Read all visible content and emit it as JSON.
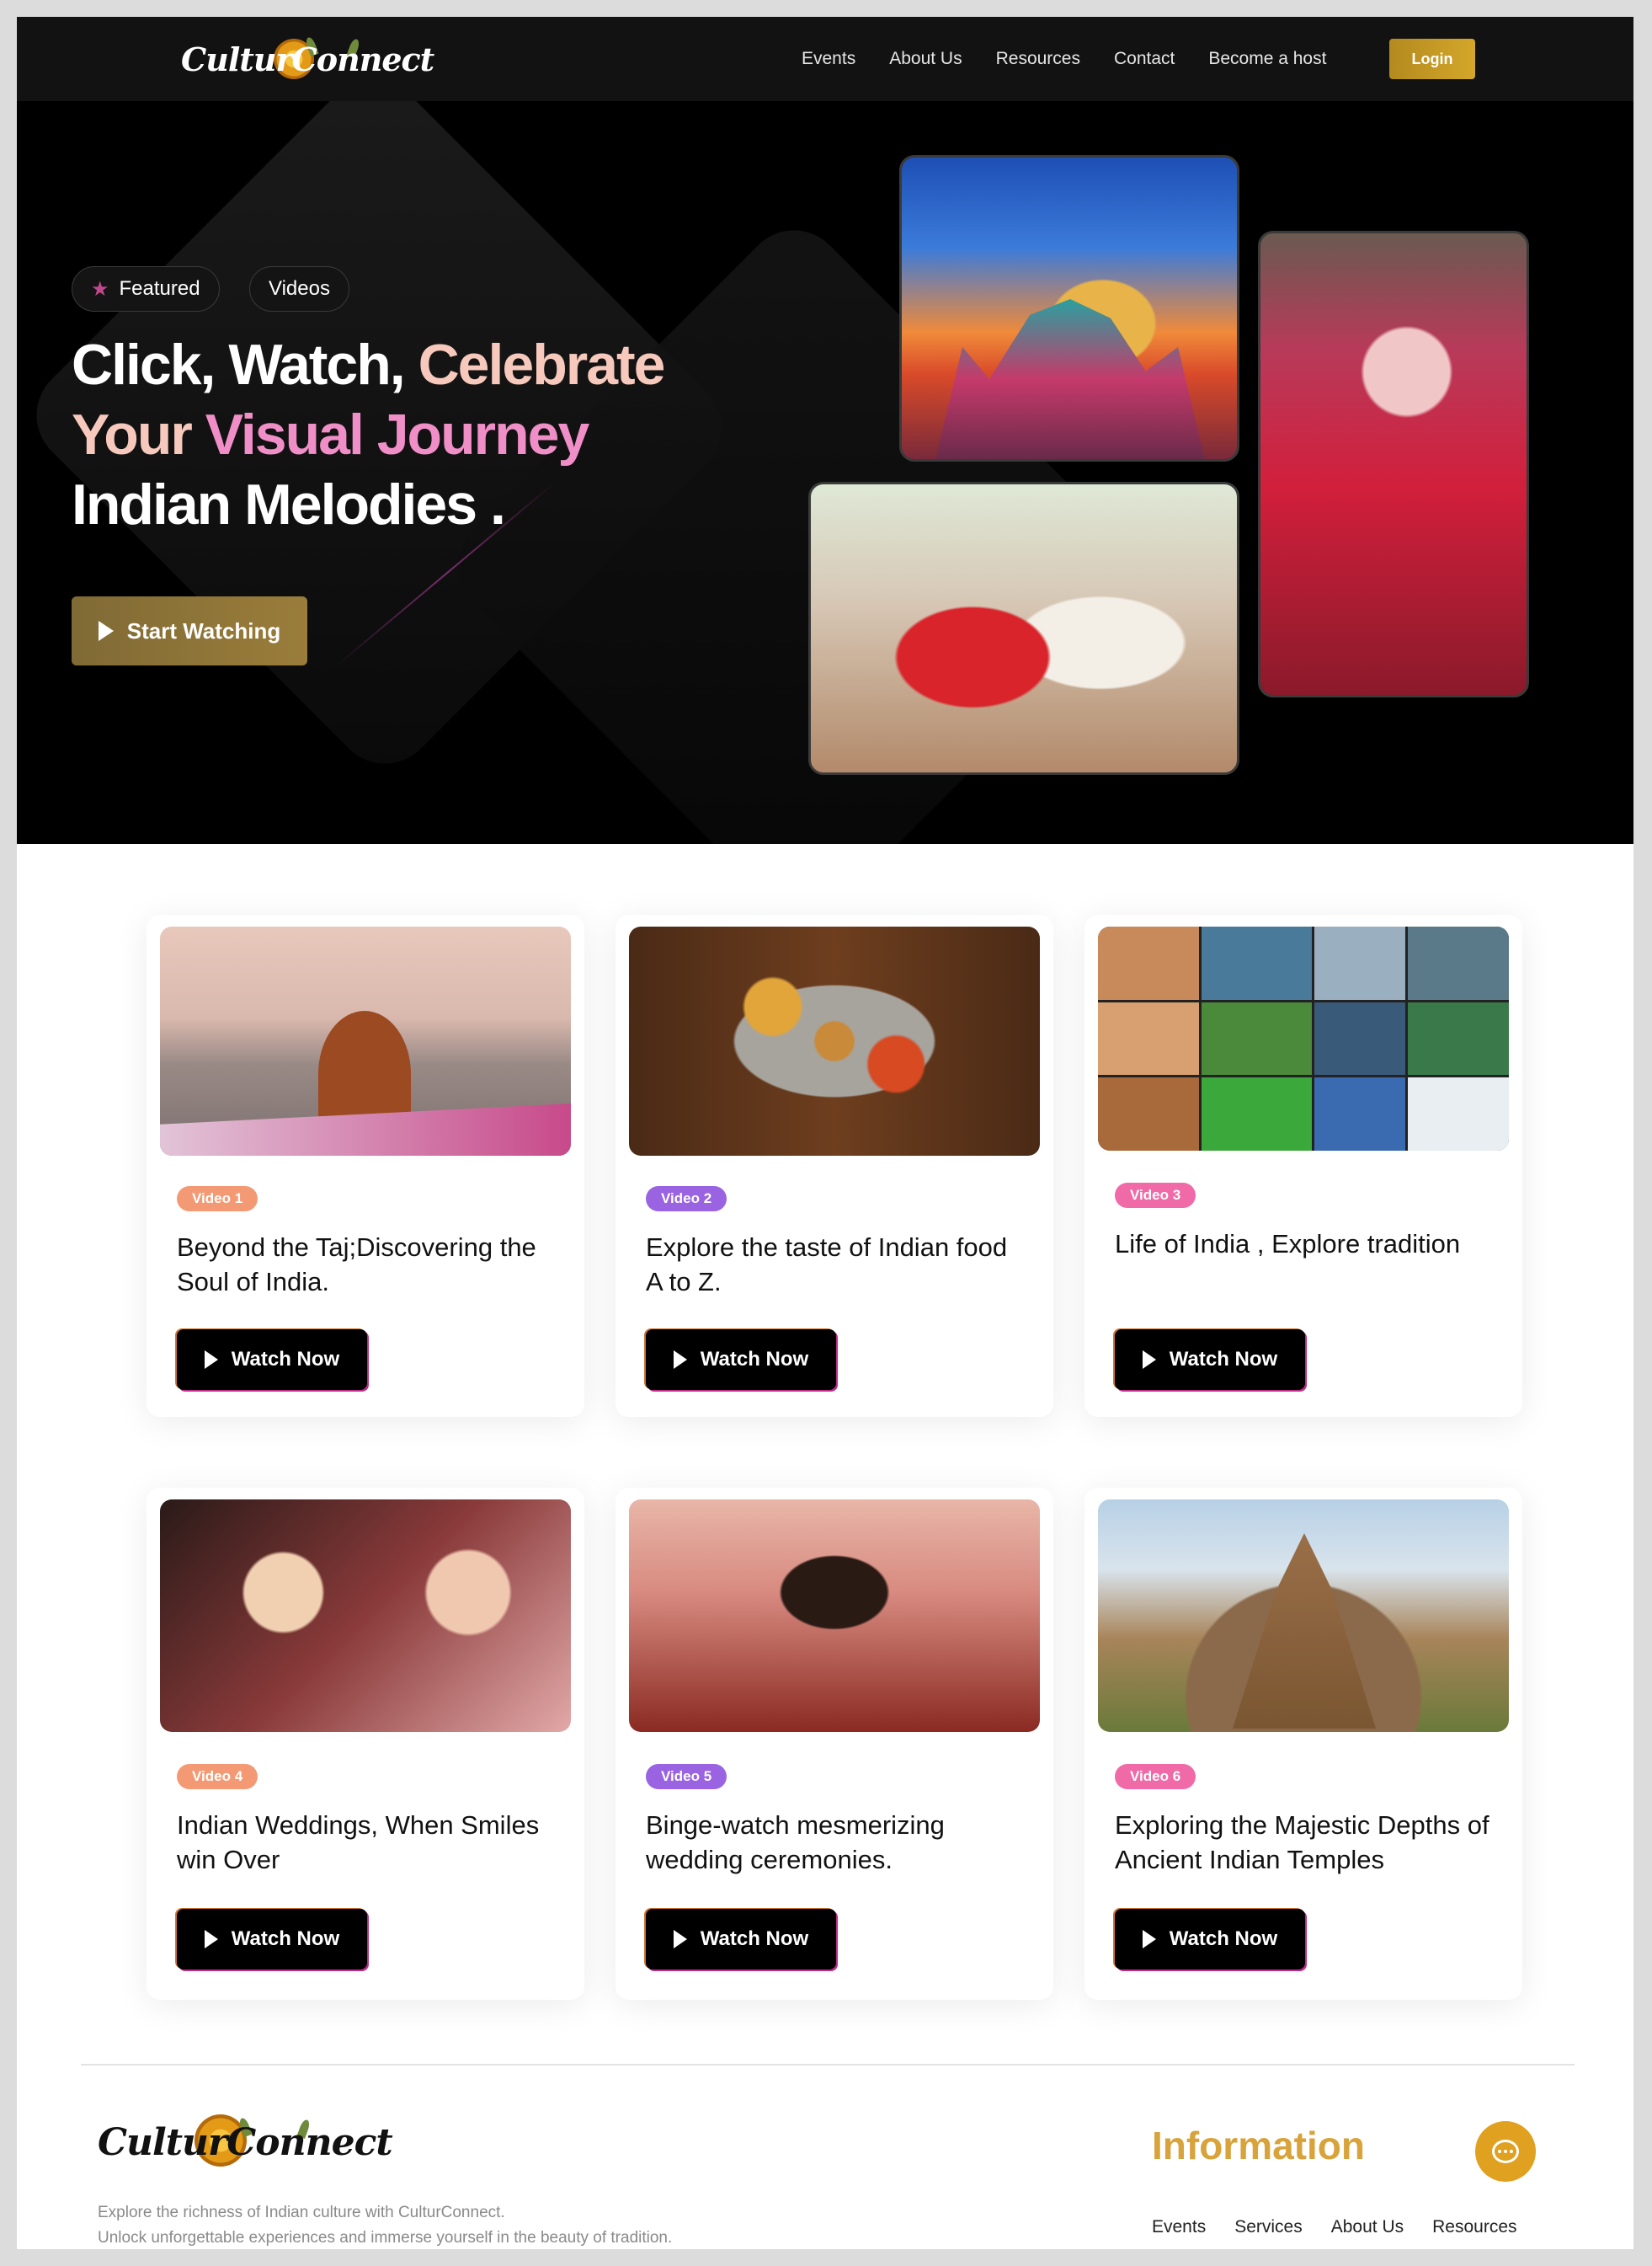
{
  "brand": {
    "logo_text": "CulturConnect"
  },
  "nav": {
    "links": [
      "Events",
      "About Us",
      "Resources",
      "Contact",
      "Become a host"
    ],
    "login_label": "Login"
  },
  "hero": {
    "pill_featured": "Featured",
    "pill_videos": "Videos",
    "title_line1_a": "Click, Watch, ",
    "title_line1_b": "Celebrate",
    "title_line2_a": "Your ",
    "title_line2_b": "Visual Journey",
    "title_line3": "Indian Melodies .",
    "cta_label": "Start Watching"
  },
  "videos": [
    {
      "badge": "Video 1",
      "title": "Beyond the Taj;Discovering the Soul of India.",
      "button": "Watch Now",
      "badge_color": "#f39a74"
    },
    {
      "badge": "Video 2",
      "title": "Explore the taste of Indian food A to Z.",
      "button": "Watch Now",
      "badge_color": "#9a63e2"
    },
    {
      "badge": "Video 3",
      "title": "Life of India , Explore tradition",
      "button": "Watch Now",
      "badge_color": "#f06aa8"
    },
    {
      "badge": "Video 4",
      "title": "Indian Weddings, When Smiles win Over",
      "button": "Watch Now",
      "badge_color": "#f39a74"
    },
    {
      "badge": "Video 5",
      "title": "Binge-watch mesmerizing wedding ceremonies.",
      "button": "Watch Now",
      "badge_color": "#9a63e2"
    },
    {
      "badge": "Video 6",
      "title": "Exploring the Majestic Depths of Ancient Indian Temples",
      "button": "Watch Now",
      "badge_color": "#f06aa8"
    }
  ],
  "footer": {
    "logo_text": "CulturConnect",
    "desc_line1": "Explore the richness of Indian culture with CulturConnect.",
    "desc_line2": "Unlock unforgettable experiences and immerse yourself in the beauty of tradition.",
    "info_heading": "Information",
    "links": [
      "Events",
      "Services",
      "About Us",
      "Resources"
    ]
  },
  "colors": {
    "accent_gold": "#d4a62a",
    "nav_bg": "#121212",
    "hero_bg": "#000000"
  },
  "icons": {
    "hero_star": "star-icon",
    "play": "play-icon",
    "chat": "chat-icon"
  }
}
